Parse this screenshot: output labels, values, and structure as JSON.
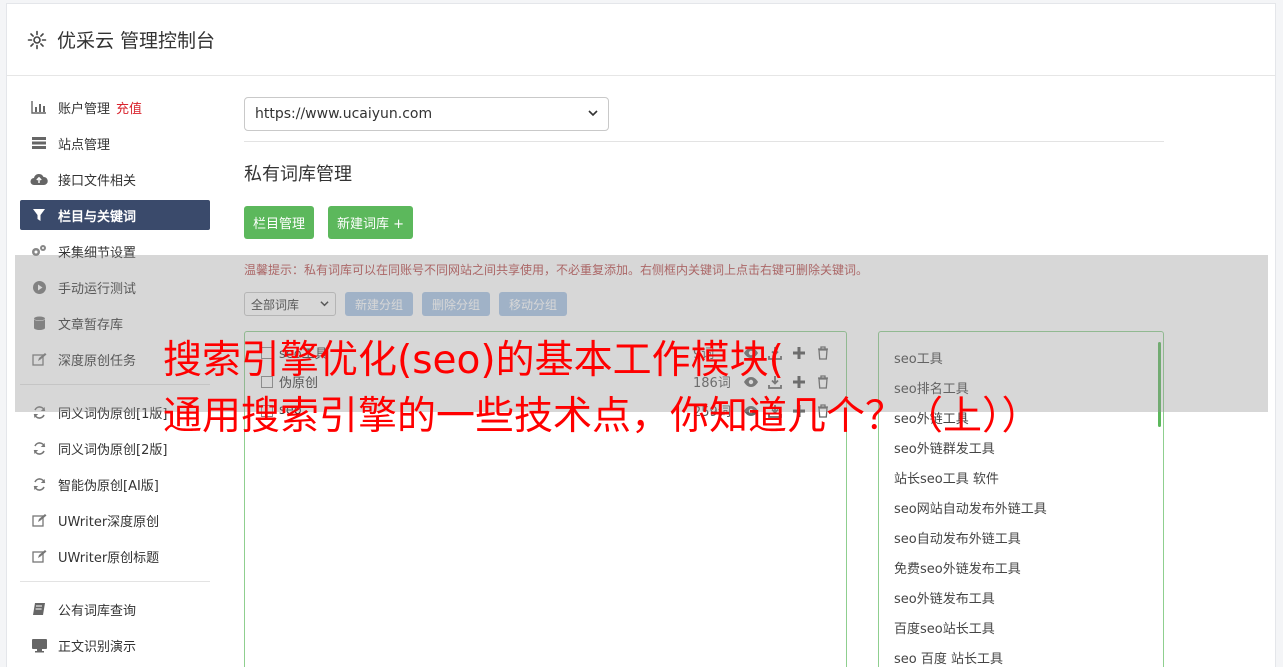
{
  "header": {
    "title": "优采云 管理控制台",
    "icon": "gear-icon"
  },
  "sidebar": {
    "groups": [
      [
        {
          "label": "账户管理",
          "extra": "充值",
          "icon": "bar-chart-icon",
          "active": false
        },
        {
          "label": "站点管理",
          "icon": "server-icon",
          "active": false
        },
        {
          "label": "接口文件相关",
          "icon": "cloud-upload-icon",
          "active": false
        },
        {
          "label": "栏目与关键词",
          "icon": "filter-icon",
          "active": true
        },
        {
          "label": "采集细节设置",
          "icon": "cogs-icon",
          "active": false
        },
        {
          "label": "手动运行测试",
          "icon": "play-circle-icon",
          "active": false
        },
        {
          "label": "文章暂存库",
          "icon": "database-icon",
          "active": false
        },
        {
          "label": "深度原创任务",
          "icon": "edit-icon",
          "active": false
        }
      ],
      [
        {
          "label": "同义词伪原创[1版]",
          "icon": "refresh-icon",
          "active": false
        },
        {
          "label": "同义词伪原创[2版]",
          "icon": "refresh-icon",
          "active": false
        },
        {
          "label": "智能伪原创[AI版]",
          "icon": "refresh-icon",
          "active": false
        },
        {
          "label": "UWriter深度原创",
          "icon": "edit-icon",
          "active": false
        },
        {
          "label": "UWriter原创标题",
          "icon": "edit-icon",
          "active": false
        }
      ],
      [
        {
          "label": "公有词库查询",
          "icon": "book-icon",
          "active": false
        },
        {
          "label": "正文识别演示",
          "icon": "monitor-icon",
          "active": false
        }
      ]
    ]
  },
  "main": {
    "site_select": "https://www.ucaiyun.com",
    "section_title": "私有词库管理",
    "buttons": {
      "column_manage": "栏目管理",
      "new_library": "新建词库 +"
    },
    "tip": "温馨提示：私有词库可以在同账号不同网站之间共享使用，不必重复添加。右侧框内关键词上点击右键可删除关键词。",
    "filter_select": "全部词库",
    "group_buttons": [
      "新建分组",
      "删除分组",
      "移动分组"
    ],
    "libraries": [
      {
        "name": "seo工具",
        "count": "9词"
      },
      {
        "name": "伪原创",
        "count": "186词"
      },
      {
        "name": "seo",
        "count": "259词"
      }
    ],
    "keywords": [
      "seo工具",
      "seo排名工具",
      "seo外链工具",
      "seo外链群发工具",
      "站长seo工具 软件",
      "seo网站自动发布外链工具",
      "seo自动发布外链工具",
      "免费seo外链发布工具",
      "seo外链发布工具",
      "百度seo站长工具",
      "seo 百度 站长工具"
    ]
  },
  "overlay": {
    "line1": "搜索引擎优化(seo)的基本工作模块(",
    "line2": "通用搜索引擎的一些技术点，你知道几个？（上））"
  },
  "colors": {
    "active_nav": "#3a4a6b",
    "green": "#5cb85c",
    "blue_btn": "#a7c4e6",
    "overlay_text": "#ff0000"
  }
}
